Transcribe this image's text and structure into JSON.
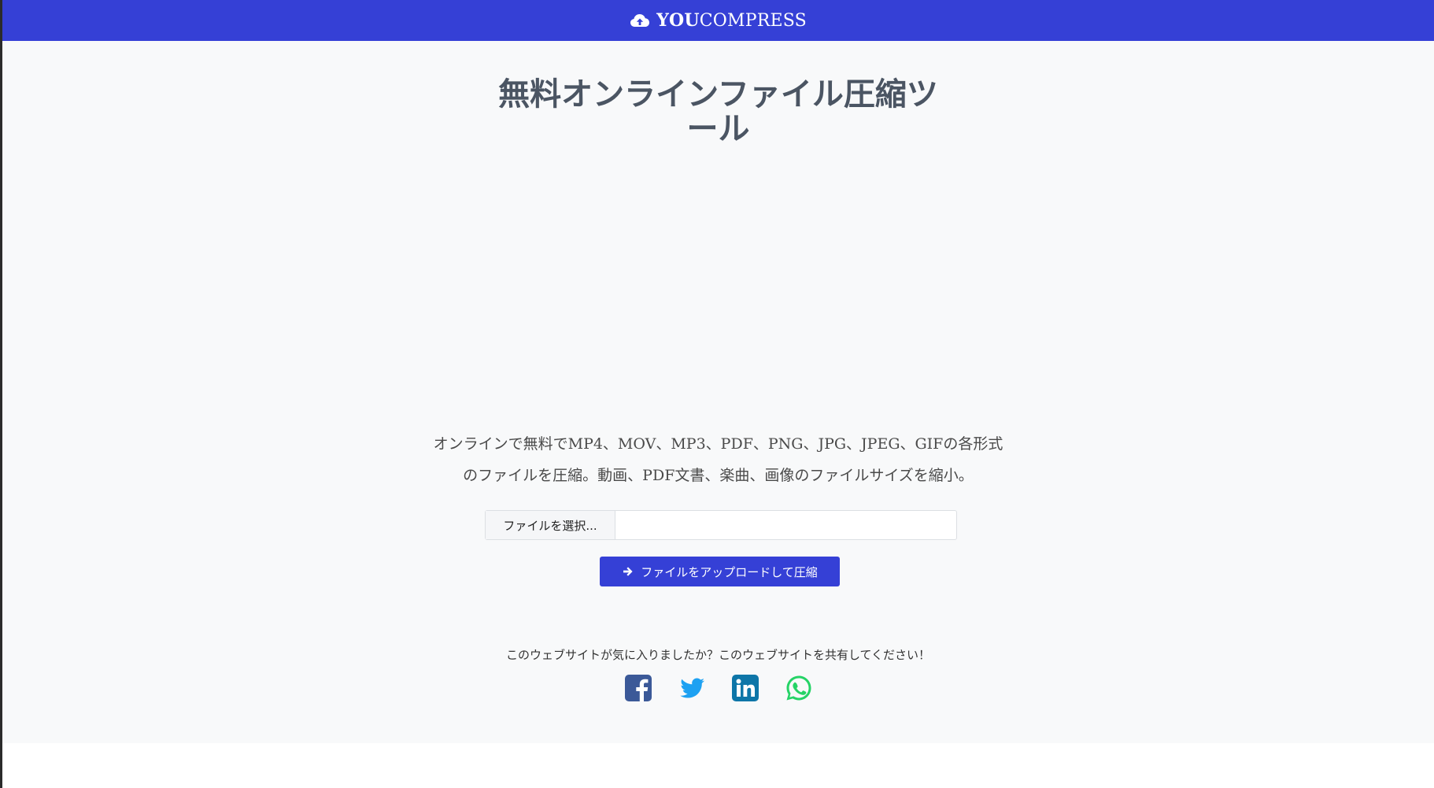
{
  "brand": {
    "name_bold": "YOU",
    "name_light": "COMPRESS",
    "icon": "cloud-upload-icon"
  },
  "main": {
    "title_line1": "無料オンラインファイル圧縮ツ",
    "title_line2": "ール",
    "description_line1": "オンラインで無料でMP4、MOV、MP3、PDF、PNG、JPG、JPEG、GIFの各形式",
    "description_line2": "のファイルを圧縮。動画、PDF文書、楽曲、画像のファイルサイズを縮小。"
  },
  "upload": {
    "choose_label": "ファイルを選択...",
    "file_value": "",
    "button_label": "ファイルをアップロードして圧縮",
    "button_icon": "arrow-right-icon"
  },
  "share": {
    "text": "このウェブサイトが気に入りましたか？このウェブサイトを共有してください！",
    "icons": [
      "facebook-icon",
      "twitter-icon",
      "linkedin-icon",
      "whatsapp-icon"
    ]
  },
  "colors": {
    "primary": "#3540d6",
    "facebook": "#3b5998",
    "twitter": "#1da1f2",
    "linkedin": "#0e76a8",
    "whatsapp": "#25d366"
  }
}
